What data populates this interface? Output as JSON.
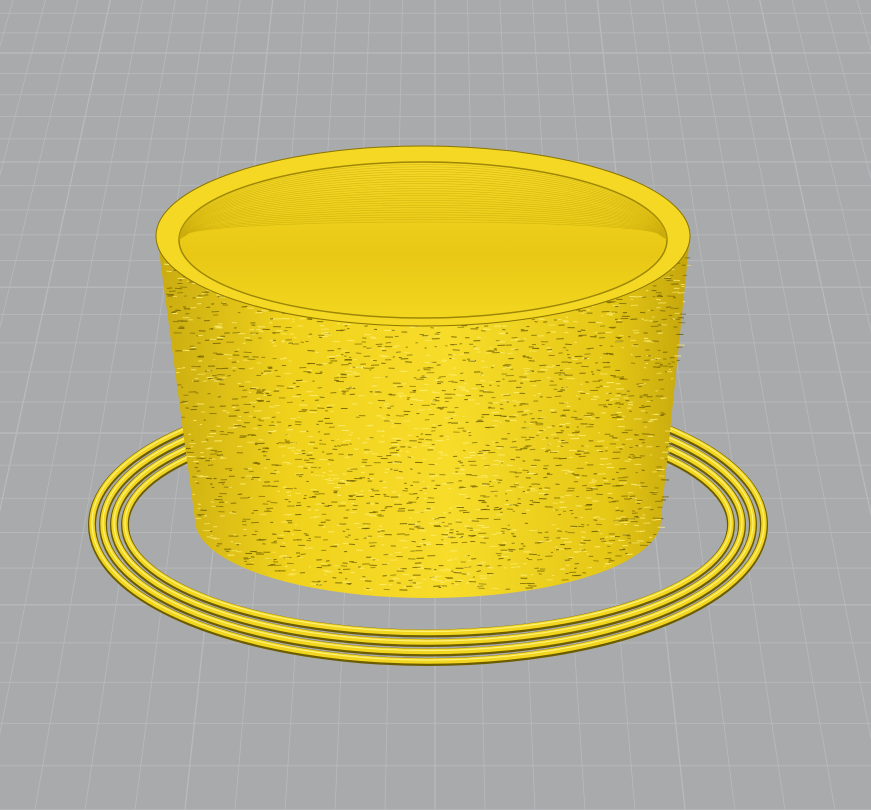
{
  "viewport": {
    "kind": "3d-print-preview",
    "colors": {
      "background": "#a9aaac",
      "grid_line": "#b9babc",
      "model": "#f2d51e",
      "model_shadow": "#b49a08",
      "model_highlight": "#fff27a"
    },
    "objects": [
      {
        "name": "cylinder-cup",
        "surface": "fuzzy-skin"
      },
      {
        "name": "skirt",
        "loops": 4
      }
    ]
  }
}
